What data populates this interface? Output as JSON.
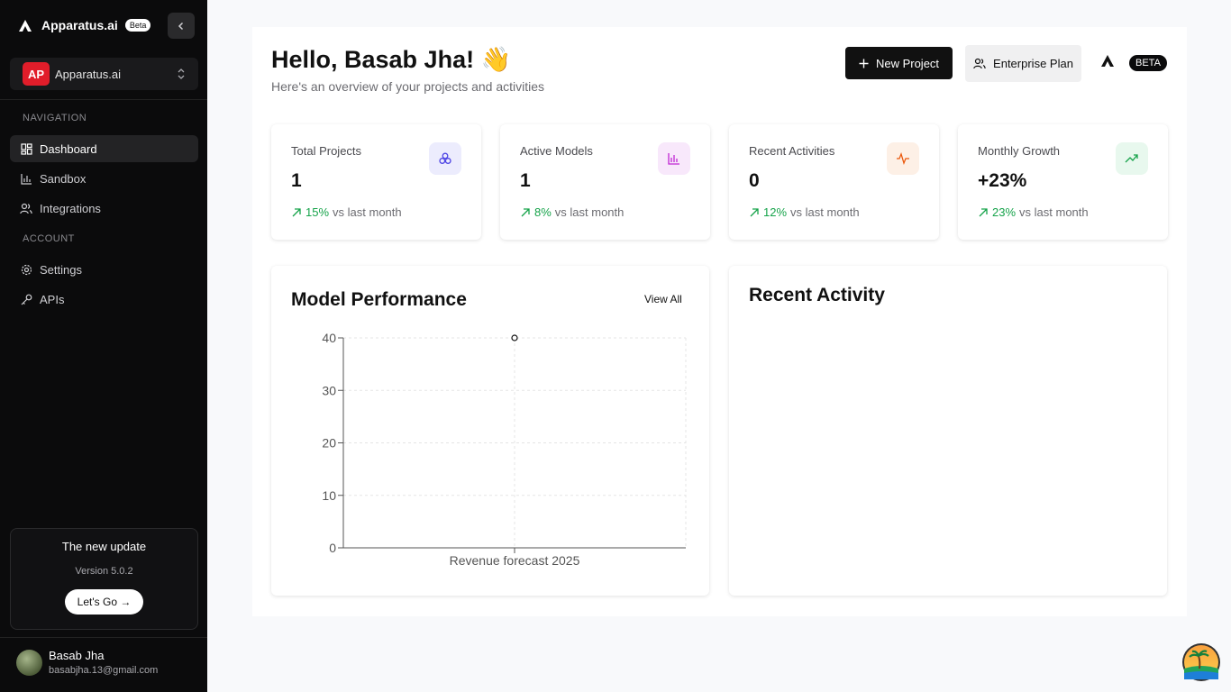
{
  "sidebar": {
    "app_name": "Apparatus.ai",
    "beta_label": "Beta",
    "workspace": {
      "initials": "AP",
      "name": "Apparatus.ai"
    },
    "nav_label": "NAVIGATION",
    "account_label": "ACCOUNT",
    "nav_items": [
      {
        "label": "Dashboard",
        "icon": "dashboard-icon",
        "active": true
      },
      {
        "label": "Sandbox",
        "icon": "bar-chart-icon",
        "active": false
      },
      {
        "label": "Integrations",
        "icon": "users-icon",
        "active": false
      }
    ],
    "account_items": [
      {
        "label": "Settings",
        "icon": "gear-icon"
      },
      {
        "label": "APIs",
        "icon": "key-icon"
      }
    ],
    "update": {
      "title": "The new update",
      "version": "Version 5.0.2",
      "button": "Let's Go →"
    },
    "user": {
      "name": "Basab Jha",
      "email": "basabjha.13@gmail.com"
    }
  },
  "header": {
    "greeting": "Hello, Basab Jha! 👋",
    "subtitle": "Here's an overview of your projects and activities",
    "new_project": "New Project",
    "enterprise_plan": "Enterprise Plan",
    "beta_badge": "BETA"
  },
  "stats": [
    {
      "label": "Total Projects",
      "value": "1",
      "pct": "15%",
      "suffix": "vs last month",
      "icon": "cubes-icon",
      "icon_bg": "#ececfd",
      "icon_color": "#4f46e5"
    },
    {
      "label": "Active Models",
      "value": "1",
      "pct": "8%",
      "suffix": "vs last month",
      "icon": "bar-chart-icon",
      "icon_bg": "#f8e8fb",
      "icon_color": "#c026d3"
    },
    {
      "label": "Recent Activities",
      "value": "0",
      "pct": "12%",
      "suffix": "vs last month",
      "icon": "activity-icon",
      "icon_bg": "#fdf0e6",
      "icon_color": "#ea580c"
    },
    {
      "label": "Monthly Growth",
      "value": "+23%",
      "pct": "23%",
      "suffix": "vs last month",
      "icon": "trending-up-icon",
      "icon_bg": "#e8f8ee",
      "icon_color": "#16a34a"
    }
  ],
  "model_performance": {
    "title": "Model Performance",
    "view_all": "View All"
  },
  "recent_activity": {
    "title": "Recent Activity"
  },
  "chart_data": {
    "type": "line",
    "categories": [
      "Revenue forecast 2025"
    ],
    "series": [
      {
        "values": [
          40
        ]
      }
    ],
    "ylim": [
      0,
      40
    ],
    "yticks": [
      0,
      10,
      20,
      30,
      40
    ],
    "grid": true,
    "point_color": "#111111"
  }
}
